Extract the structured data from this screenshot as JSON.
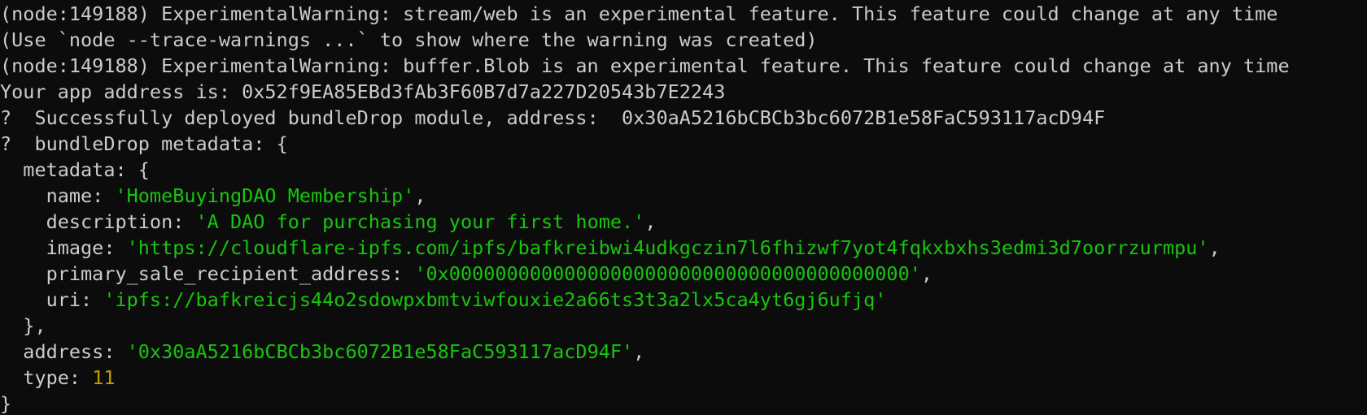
{
  "terminal": {
    "colors": {
      "background": "#0c0c0c",
      "text": "#cccccc",
      "string": "#16c60c",
      "number": "#c19c00"
    },
    "warnings": [
      "(node:149188) ExperimentalWarning: stream/web is an experimental feature. This feature could change at any time",
      "(Use `node --trace-warnings ...` to show where the warning was created)",
      "(node:149188) ExperimentalWarning: buffer.Blob is an experimental feature. This feature could change at any time"
    ],
    "app_address_line": "Your app address is: 0x52f9EA85EBd3fAb3F60B7d7a227D20543b7E2243",
    "deploy_glyph": "?",
    "deploy_line": "  Successfully deployed bundleDrop module, address:  0x30aA5216bCBCb3bc6072B1e58FaC593117acD94F",
    "meta_glyph": "?",
    "meta_header": "  bundleDrop metadata: {",
    "metadata_open": "  metadata: {",
    "fields": {
      "name_key": "    name: ",
      "name_val": "'HomeBuyingDAO Membership'",
      "description_key": "    description: ",
      "description_val": "'A DAO for purchasing your first home.'",
      "image_key": "    image: ",
      "image_val": "'https://cloudflare-ipfs.com/ipfs/bafkreibwi4udkgczin7l6fhizwf7yot4fqkxbxhs3edmi3d7oorrzurmpu'",
      "psra_key": "    primary_sale_recipient_address: ",
      "psra_val": "'0x0000000000000000000000000000000000000000'",
      "uri_key": "    uri: ",
      "uri_val": "'ipfs://bafkreicjs44o2sdowpxbmtviwfouxie2a66ts3t3a2lx5ca4yt6gj6ufjq'"
    },
    "comma": ",",
    "metadata_close": "  },",
    "address_key": "  address: ",
    "address_val": "'0x30aA5216bCBCb3bc6072B1e58FaC593117acD94F'",
    "type_key": "  type: ",
    "type_val": "11",
    "closing_brace": "}"
  }
}
